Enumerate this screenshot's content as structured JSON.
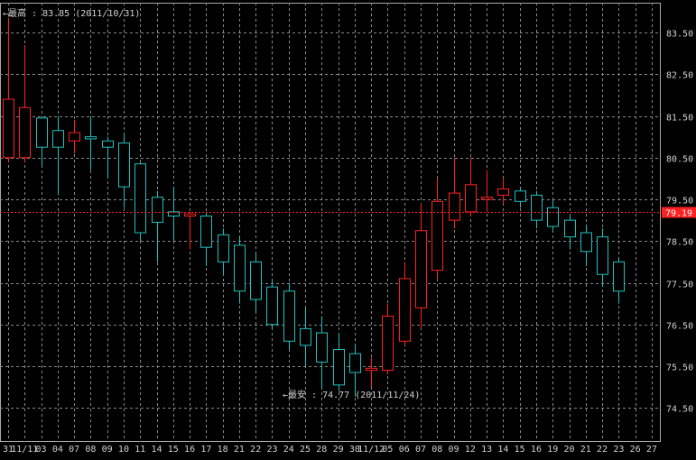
{
  "chart_data": {
    "type": "candlestick",
    "ylim": [
      74.0,
      84.0
    ],
    "y_ticks": [
      "83.50",
      "82.50",
      "81.50",
      "80.50",
      "79.50",
      "78.50",
      "77.50",
      "76.50",
      "75.50",
      "74.50"
    ],
    "x_labels": [
      "31",
      "11/11",
      "03",
      "04",
      "07",
      "08",
      "09",
      "10",
      "11",
      "14",
      "15",
      "16",
      "17",
      "18",
      "21",
      "22",
      "23",
      "24",
      "25",
      "28",
      "29",
      "30",
      "11/12",
      "05",
      "06",
      "07",
      "08",
      "09",
      "12",
      "13",
      "14",
      "15",
      "16",
      "19",
      "20",
      "21",
      "22",
      "23",
      "26",
      "27"
    ],
    "current_price": 79.19,
    "current_label": "79.19",
    "high_annotation": "←最高 : 83.85 (2011/10/31)",
    "low_annotation": "←最安 : 74.77 (2011/11/24)",
    "colors": {
      "up": "#ff2020",
      "down": "#20c0c0",
      "grid": "#888888",
      "text": "#d0d0d0",
      "current": "#ff2020"
    },
    "candles": [
      {
        "o": 80.5,
        "h": 83.85,
        "l": 80.4,
        "c": 81.9
      },
      {
        "o": 80.5,
        "h": 83.2,
        "l": 80.4,
        "c": 81.7
      },
      {
        "o": 81.45,
        "h": 81.5,
        "l": 80.3,
        "c": 80.75
      },
      {
        "o": 81.15,
        "h": 81.5,
        "l": 79.6,
        "c": 80.75
      },
      {
        "o": 80.9,
        "h": 81.4,
        "l": 80.6,
        "c": 81.1
      },
      {
        "o": 81.0,
        "h": 81.5,
        "l": 80.2,
        "c": 80.95
      },
      {
        "o": 80.9,
        "h": 81.0,
        "l": 80.0,
        "c": 80.75
      },
      {
        "o": 80.85,
        "h": 81.1,
        "l": 79.3,
        "c": 79.8
      },
      {
        "o": 80.35,
        "h": 80.4,
        "l": 78.5,
        "c": 78.7
      },
      {
        "o": 79.55,
        "h": 79.7,
        "l": 78.0,
        "c": 78.95
      },
      {
        "o": 79.2,
        "h": 79.8,
        "l": 78.5,
        "c": 79.1
      },
      {
        "o": 79.1,
        "h": 79.2,
        "l": 78.3,
        "c": 79.15
      },
      {
        "o": 79.1,
        "h": 79.2,
        "l": 77.9,
        "c": 78.35
      },
      {
        "o": 78.65,
        "h": 78.8,
        "l": 77.7,
        "c": 78.0
      },
      {
        "o": 78.4,
        "h": 78.6,
        "l": 77.0,
        "c": 77.3
      },
      {
        "o": 78.0,
        "h": 78.2,
        "l": 76.8,
        "c": 77.1
      },
      {
        "o": 77.4,
        "h": 77.6,
        "l": 76.4,
        "c": 76.5
      },
      {
        "o": 77.3,
        "h": 77.5,
        "l": 75.9,
        "c": 76.1
      },
      {
        "o": 76.4,
        "h": 76.9,
        "l": 75.5,
        "c": 76.0
      },
      {
        "o": 76.3,
        "h": 76.7,
        "l": 75.0,
        "c": 75.6
      },
      {
        "o": 75.9,
        "h": 76.3,
        "l": 74.9,
        "c": 75.05
      },
      {
        "o": 75.8,
        "h": 76.0,
        "l": 74.77,
        "c": 75.35
      },
      {
        "o": 75.4,
        "h": 75.7,
        "l": 75.0,
        "c": 75.45
      },
      {
        "o": 75.4,
        "h": 77.0,
        "l": 75.3,
        "c": 76.7
      },
      {
        "o": 76.1,
        "h": 78.0,
        "l": 76.0,
        "c": 77.6
      },
      {
        "o": 76.9,
        "h": 79.4,
        "l": 76.4,
        "c": 78.75
      },
      {
        "o": 77.8,
        "h": 80.0,
        "l": 77.6,
        "c": 79.45
      },
      {
        "o": 79.0,
        "h": 80.5,
        "l": 78.8,
        "c": 79.65
      },
      {
        "o": 79.2,
        "h": 80.5,
        "l": 79.1,
        "c": 79.85
      },
      {
        "o": 79.5,
        "h": 80.2,
        "l": 79.2,
        "c": 79.55
      },
      {
        "o": 79.6,
        "h": 80.0,
        "l": 79.4,
        "c": 79.75
      },
      {
        "o": 79.7,
        "h": 79.8,
        "l": 79.3,
        "c": 79.45
      },
      {
        "o": 79.6,
        "h": 79.7,
        "l": 78.8,
        "c": 79.0
      },
      {
        "o": 79.3,
        "h": 79.5,
        "l": 78.7,
        "c": 78.85
      },
      {
        "o": 79.0,
        "h": 79.1,
        "l": 78.3,
        "c": 78.6
      },
      {
        "o": 78.7,
        "h": 78.9,
        "l": 77.9,
        "c": 78.25
      },
      {
        "o": 78.6,
        "h": 78.8,
        "l": 77.4,
        "c": 77.7
      },
      {
        "o": 78.0,
        "h": 78.1,
        "l": 77.0,
        "c": 77.3
      }
    ]
  }
}
